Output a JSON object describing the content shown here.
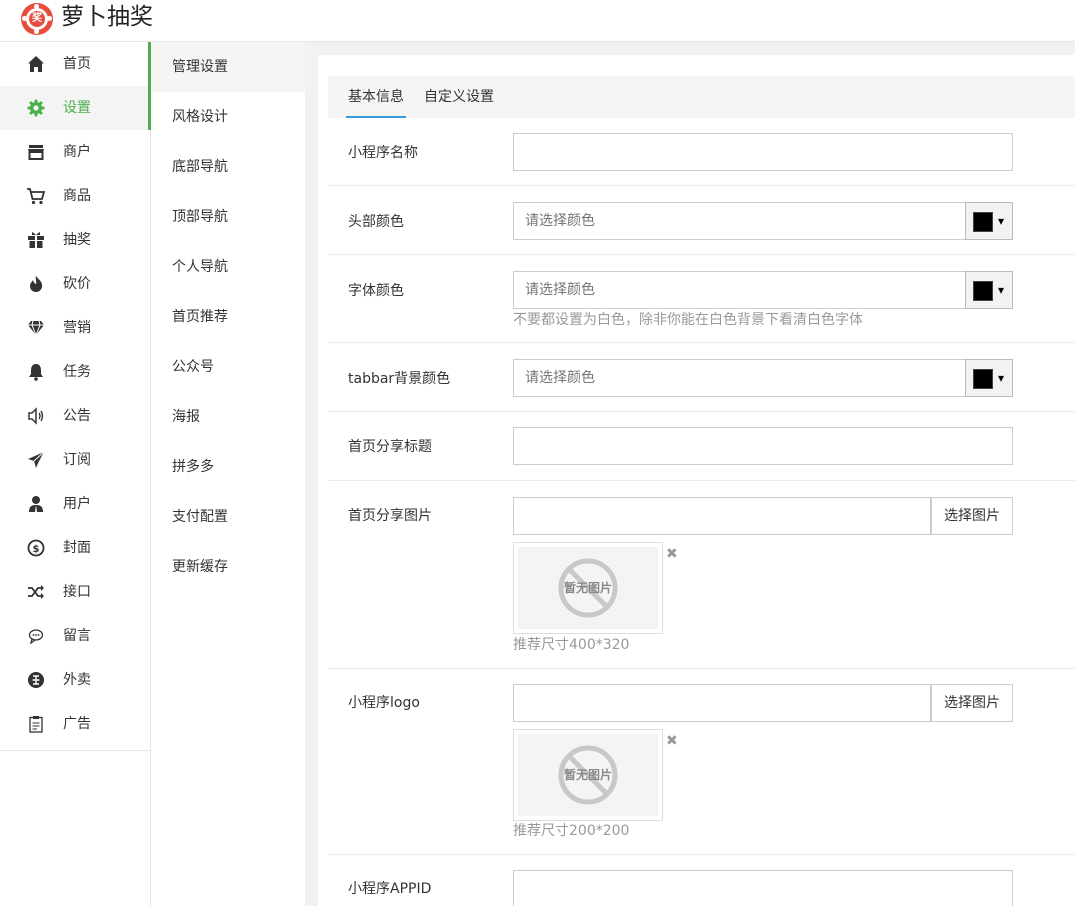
{
  "app": {
    "title": "萝卜抽奖",
    "logo_char": "奖",
    "accent": "#e84c3d",
    "active_color": "#4cae4c"
  },
  "nav": [
    {
      "label": "首页",
      "icon": "home-icon"
    },
    {
      "label": "设置",
      "icon": "gear-icon",
      "active": true
    },
    {
      "label": "商户",
      "icon": "store-icon"
    },
    {
      "label": "商品",
      "icon": "cart-icon"
    },
    {
      "label": "抽奖",
      "icon": "gift-icon"
    },
    {
      "label": "砍价",
      "icon": "fire-icon"
    },
    {
      "label": "营销",
      "icon": "diamond-icon"
    },
    {
      "label": "任务",
      "icon": "bell-icon"
    },
    {
      "label": "公告",
      "icon": "speaker-icon"
    },
    {
      "label": "订阅",
      "icon": "paper-plane-icon"
    },
    {
      "label": "用户",
      "icon": "user-icon"
    },
    {
      "label": "封面",
      "icon": "dollar-icon"
    },
    {
      "label": "接口",
      "icon": "shuffle-icon"
    },
    {
      "label": "留言",
      "icon": "comment-icon"
    },
    {
      "label": "外卖",
      "icon": "takeout-icon"
    },
    {
      "label": "广告",
      "icon": "clipboard-icon"
    }
  ],
  "subnav": [
    "管理设置",
    "风格设计",
    "底部导航",
    "顶部导航",
    "个人导航",
    "首页推荐",
    "公众号",
    "海报",
    "拼多多",
    "支付配置",
    "更新缓存"
  ],
  "tabs": [
    "基本信息",
    "自定义设置"
  ],
  "form": {
    "name_label": "小程序名称",
    "header_color_label": "头部颜色",
    "font_color_label": "字体颜色",
    "font_color_hint": "不要都设置为白色，除非你能在白色背景下看清白色字体",
    "tabbar_color_label": "tabbar背景颜色",
    "color_placeholder": "请选择颜色",
    "share_title_label": "首页分享标题",
    "share_image_label": "首页分享图片",
    "share_image_size": "推荐尺寸400*320",
    "logo_label": "小程序logo",
    "logo_size": "推荐尺寸200*200",
    "appid_label": "小程序APPID",
    "pick_image": "选择图片",
    "no_image": "暂无图片",
    "remove_mark": "✖",
    "swatch_color": "#000000",
    "caret": "▾"
  }
}
